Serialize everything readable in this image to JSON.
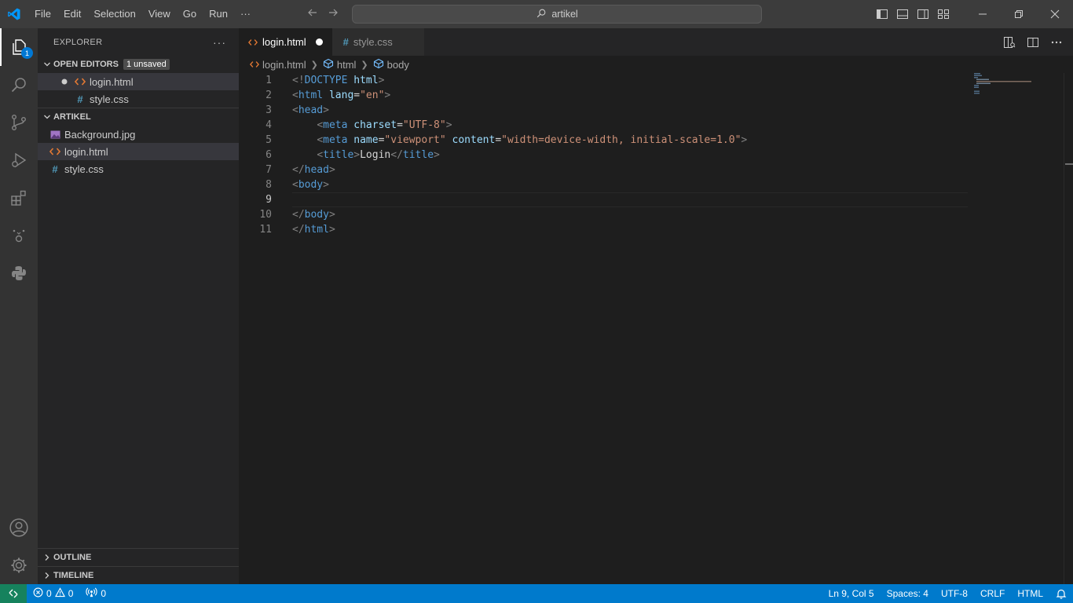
{
  "menu": {
    "items": [
      "File",
      "Edit",
      "Selection",
      "View",
      "Go",
      "Run",
      "···"
    ]
  },
  "command_center": {
    "text": "artikel"
  },
  "activity": {
    "explorer_badge": "1"
  },
  "sidebar": {
    "title": "EXPLORER",
    "more": "···",
    "open_editors": {
      "label": "OPEN EDITORS",
      "badge": "1 unsaved",
      "files": [
        {
          "name": "login.html",
          "icon": "html-icon",
          "dirty": true
        },
        {
          "name": "style.css",
          "icon": "css-icon",
          "dirty": false
        }
      ]
    },
    "folder": {
      "label": "ARTIKEL",
      "files": [
        {
          "name": "Background.jpg",
          "icon": "image-icon"
        },
        {
          "name": "login.html",
          "icon": "html-icon"
        },
        {
          "name": "style.css",
          "icon": "css-icon"
        }
      ]
    },
    "outline_label": "OUTLINE",
    "timeline_label": "TIMELINE"
  },
  "tabs": [
    {
      "label": "login.html",
      "active": true,
      "dirty": true
    },
    {
      "label": "style.css",
      "active": false,
      "dirty": false
    }
  ],
  "breadcrumb": {
    "file": "login.html",
    "items": [
      "html",
      "body"
    ]
  },
  "editor": {
    "current_line": 9,
    "lines": [
      {
        "n": "1",
        "tokens": [
          [
            "b",
            "<!"
          ],
          [
            "t",
            "DOCTYPE"
          ],
          [
            "s",
            " "
          ],
          [
            "a",
            "html"
          ],
          [
            "b",
            ">"
          ]
        ]
      },
      {
        "n": "2",
        "tokens": [
          [
            "b",
            "<"
          ],
          [
            "t",
            "html"
          ],
          [
            "s",
            " "
          ],
          [
            "a",
            "lang"
          ],
          [
            "x",
            "="
          ],
          [
            "v",
            "\"en\""
          ],
          [
            "b",
            ">"
          ]
        ]
      },
      {
        "n": "3",
        "tokens": [
          [
            "b",
            "<"
          ],
          [
            "t",
            "head"
          ],
          [
            "b",
            ">"
          ]
        ]
      },
      {
        "n": "4",
        "tokens": [
          [
            "s",
            "    "
          ],
          [
            "b",
            "<"
          ],
          [
            "t",
            "meta"
          ],
          [
            "s",
            " "
          ],
          [
            "a",
            "charset"
          ],
          [
            "x",
            "="
          ],
          [
            "v",
            "\"UTF-8\""
          ],
          [
            "b",
            ">"
          ]
        ]
      },
      {
        "n": "5",
        "tokens": [
          [
            "s",
            "    "
          ],
          [
            "b",
            "<"
          ],
          [
            "t",
            "meta"
          ],
          [
            "s",
            " "
          ],
          [
            "a",
            "name"
          ],
          [
            "x",
            "="
          ],
          [
            "v",
            "\"viewport\""
          ],
          [
            "s",
            " "
          ],
          [
            "a",
            "content"
          ],
          [
            "x",
            "="
          ],
          [
            "v",
            "\"width=device-width, initial-scale=1.0\""
          ],
          [
            "b",
            ">"
          ]
        ]
      },
      {
        "n": "6",
        "tokens": [
          [
            "s",
            "    "
          ],
          [
            "b",
            "<"
          ],
          [
            "t",
            "title"
          ],
          [
            "b",
            ">"
          ],
          [
            "x",
            "Login"
          ],
          [
            "b",
            "</"
          ],
          [
            "t",
            "title"
          ],
          [
            "b",
            ">"
          ]
        ]
      },
      {
        "n": "7",
        "tokens": [
          [
            "b",
            "</"
          ],
          [
            "t",
            "head"
          ],
          [
            "b",
            ">"
          ]
        ]
      },
      {
        "n": "8",
        "tokens": [
          [
            "b",
            "<"
          ],
          [
            "t",
            "body"
          ],
          [
            "b",
            ">"
          ]
        ]
      },
      {
        "n": "9",
        "tokens": []
      },
      {
        "n": "10",
        "tokens": [
          [
            "b",
            "</"
          ],
          [
            "t",
            "body"
          ],
          [
            "b",
            ">"
          ]
        ]
      },
      {
        "n": "11",
        "tokens": [
          [
            "b",
            "</"
          ],
          [
            "t",
            "html"
          ],
          [
            "b",
            ">"
          ]
        ]
      }
    ]
  },
  "status": {
    "errors": "0",
    "warnings": "0",
    "ports": "0",
    "position": "Ln 9, Col 5",
    "spaces": "Spaces: 4",
    "encoding": "UTF-8",
    "eol": "CRLF",
    "language": "HTML"
  },
  "colors": {
    "accent": "#007acc",
    "remote": "#16825d",
    "html_icon": "#e37933",
    "css_icon": "#519aba",
    "image_icon": "#a074c4"
  }
}
